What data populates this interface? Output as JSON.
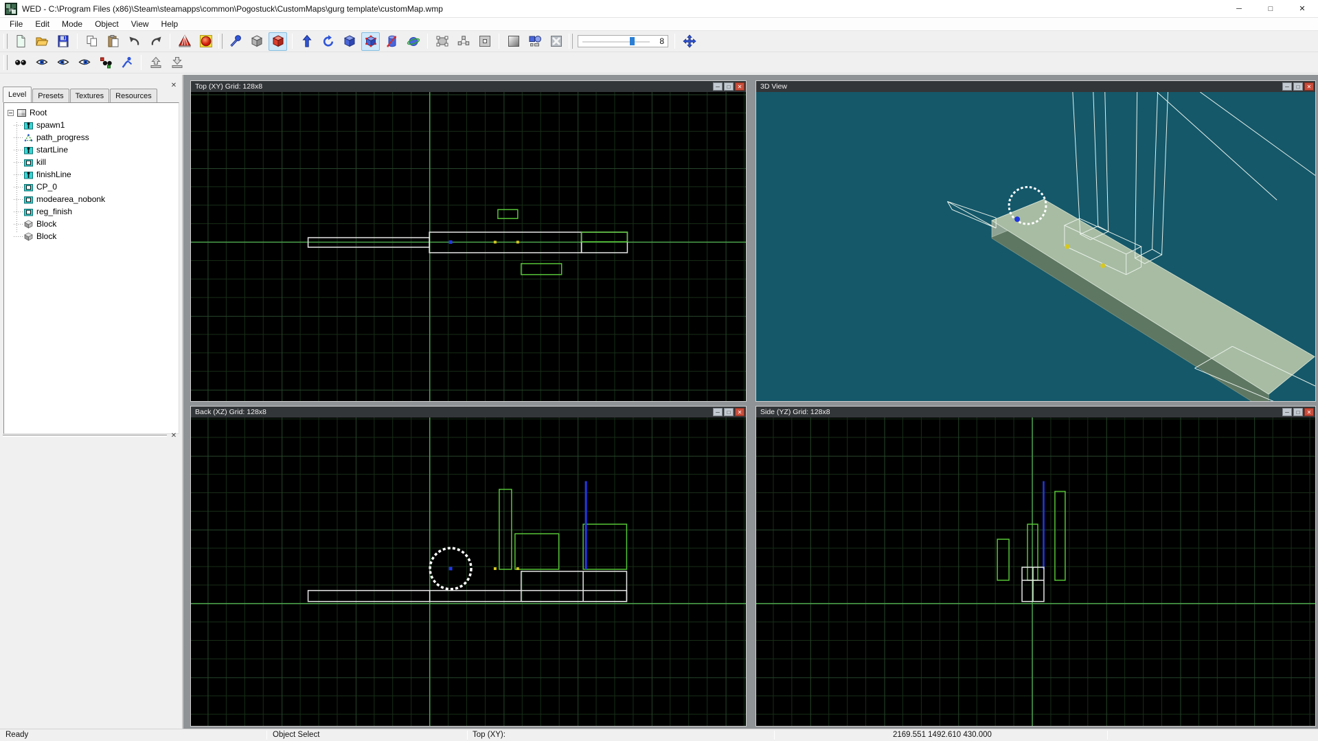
{
  "window": {
    "title": "WED - C:\\Program Files (x86)\\Steam\\steamapps\\common\\Pogostuck\\CustomMaps\\gurg template\\customMap.wmp",
    "controls": {
      "minimize": "─",
      "maximize": "□",
      "close": "✕"
    }
  },
  "menu": {
    "items": [
      "File",
      "Edit",
      "Mode",
      "Object",
      "View",
      "Help"
    ]
  },
  "toolbar_main": {
    "zoom_value": "8",
    "icons": [
      "new-file",
      "open-folder",
      "save",
      "copy",
      "paste",
      "undo",
      "redo",
      "build-level",
      "run-level",
      "select-dart",
      "object-cube-gray",
      "object-cube-red-active",
      "move-arrow",
      "rotate",
      "scale-cube",
      "vertex-edit-active",
      "edge-edit-cylinder",
      "sphere-edit",
      "group",
      "vertex-group",
      "snap-square",
      "texture-square",
      "primitives",
      "delete-x",
      "zoom-slider",
      "pan-view"
    ]
  },
  "toolbar_secondary": {
    "icons": [
      "eyes-pair",
      "eye-view-1",
      "eye-view-2",
      "eye-view-3",
      "eye-marker",
      "figure-blue",
      "tray-arrow-up",
      "tray-arrow-down"
    ]
  },
  "sidebar": {
    "tabs": [
      "Level",
      "Presets",
      "Textures",
      "Resources"
    ],
    "active_tab": "Level",
    "tree": {
      "items": [
        {
          "label": "Root",
          "icon": "map-icon"
        },
        {
          "label": "spawn1",
          "icon": "entity-icon"
        },
        {
          "label": "path_progress",
          "icon": "path-icon"
        },
        {
          "label": "startLine",
          "icon": "entity-icon"
        },
        {
          "label": "kill",
          "icon": "region-icon"
        },
        {
          "label": "finishLine",
          "icon": "entity-icon"
        },
        {
          "label": "CP_0",
          "icon": "region-icon"
        },
        {
          "label": "modearea_nobonk",
          "icon": "region-icon"
        },
        {
          "label": "reg_finish",
          "icon": "region-icon"
        },
        {
          "label": "Block",
          "icon": "block-icon"
        },
        {
          "label": "Block",
          "icon": "block-icon"
        }
      ]
    }
  },
  "viewports": {
    "top_xy": {
      "title": "Top (XY) Grid: 128x8"
    },
    "view_3d": {
      "title": "3D View"
    },
    "back_xz": {
      "title": "Back (XZ) Grid: 128x8"
    },
    "side_yz": {
      "title": "Side (YZ) Grid: 128x8"
    }
  },
  "statusbar": {
    "ready": "Ready",
    "mode": "Object Select",
    "view_label": "Top (XY):",
    "coordinates": "2169.551 1492.610 430.000"
  },
  "colors": {
    "viewport_bg": "#000000",
    "view3d_bg": "#14586a",
    "grid_minor": "#182e18",
    "grid_major": "#27462b",
    "axis_green": "#4fae4f",
    "block_green": "#57c637",
    "wire_white": "#e8e8e8",
    "marker_blue": "#2238e8",
    "node_yellow": "#d6c822",
    "viewport_titlebar": "#333639",
    "close_red": "#cb4c3a"
  }
}
